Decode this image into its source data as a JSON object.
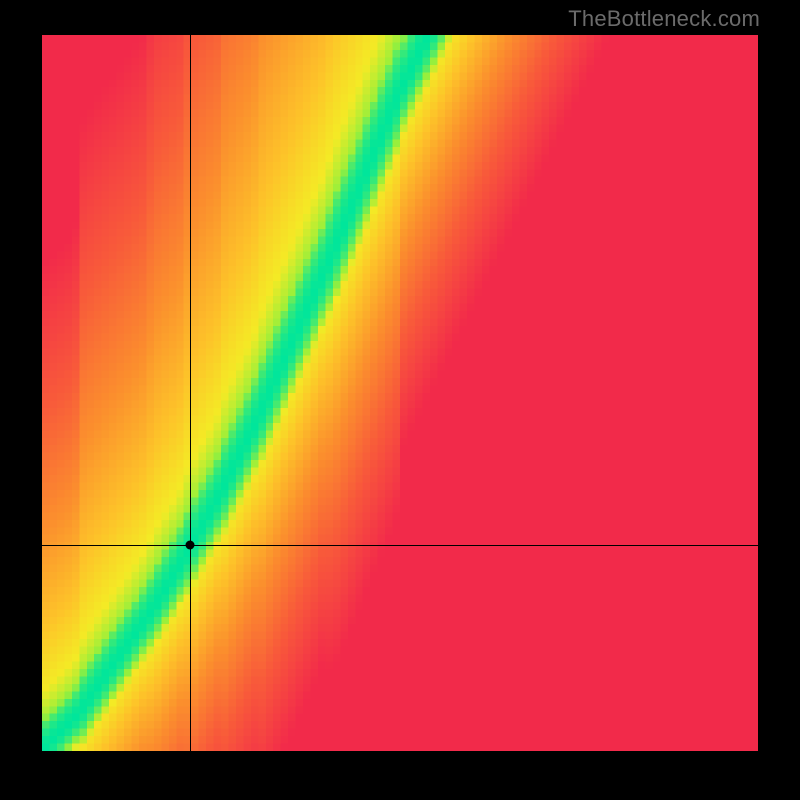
{
  "watermark": "TheBottleneck.com",
  "plot": {
    "grid_n": 96,
    "crosshair": {
      "x_frac": 0.207,
      "y_frac": 0.712
    },
    "dot": {
      "x_frac": 0.207,
      "y_frac": 0.712
    }
  },
  "chart_data": {
    "type": "heatmap",
    "title": "",
    "xlabel": "",
    "ylabel": "",
    "xlim": [
      0,
      1
    ],
    "ylim": [
      0,
      1
    ],
    "description": "Balance/bottleneck heatmap. A narrow green ridge (optimal pairing) runs from the lower-left corner to the upper edge near x≈0.54, curving gently; far from the ridge the field is red (poor balance), grading through orange/yellow near the ridge and bright cyan-green on it.",
    "ridge_curve_points": [
      {
        "x": 0.0,
        "y": 0.0
      },
      {
        "x": 0.05,
        "y": 0.05
      },
      {
        "x": 0.1,
        "y": 0.12
      },
      {
        "x": 0.15,
        "y": 0.19
      },
      {
        "x": 0.2,
        "y": 0.27
      },
      {
        "x": 0.25,
        "y": 0.36
      },
      {
        "x": 0.3,
        "y": 0.46
      },
      {
        "x": 0.35,
        "y": 0.57
      },
      {
        "x": 0.4,
        "y": 0.68
      },
      {
        "x": 0.45,
        "y": 0.8
      },
      {
        "x": 0.5,
        "y": 0.92
      },
      {
        "x": 0.54,
        "y": 1.0
      }
    ],
    "ridge_half_width_frac": 0.03,
    "color_stops": [
      {
        "t": 0.0,
        "color": "#00e69b"
      },
      {
        "t": 0.06,
        "color": "#9bef3a"
      },
      {
        "t": 0.12,
        "color": "#f4ea25"
      },
      {
        "t": 0.25,
        "color": "#fdc329"
      },
      {
        "t": 0.45,
        "color": "#fb8f2d"
      },
      {
        "t": 0.7,
        "color": "#f85a3a"
      },
      {
        "t": 1.0,
        "color": "#f22a4a"
      }
    ],
    "crosshair_point": {
      "x": 0.207,
      "y": 0.288
    }
  }
}
